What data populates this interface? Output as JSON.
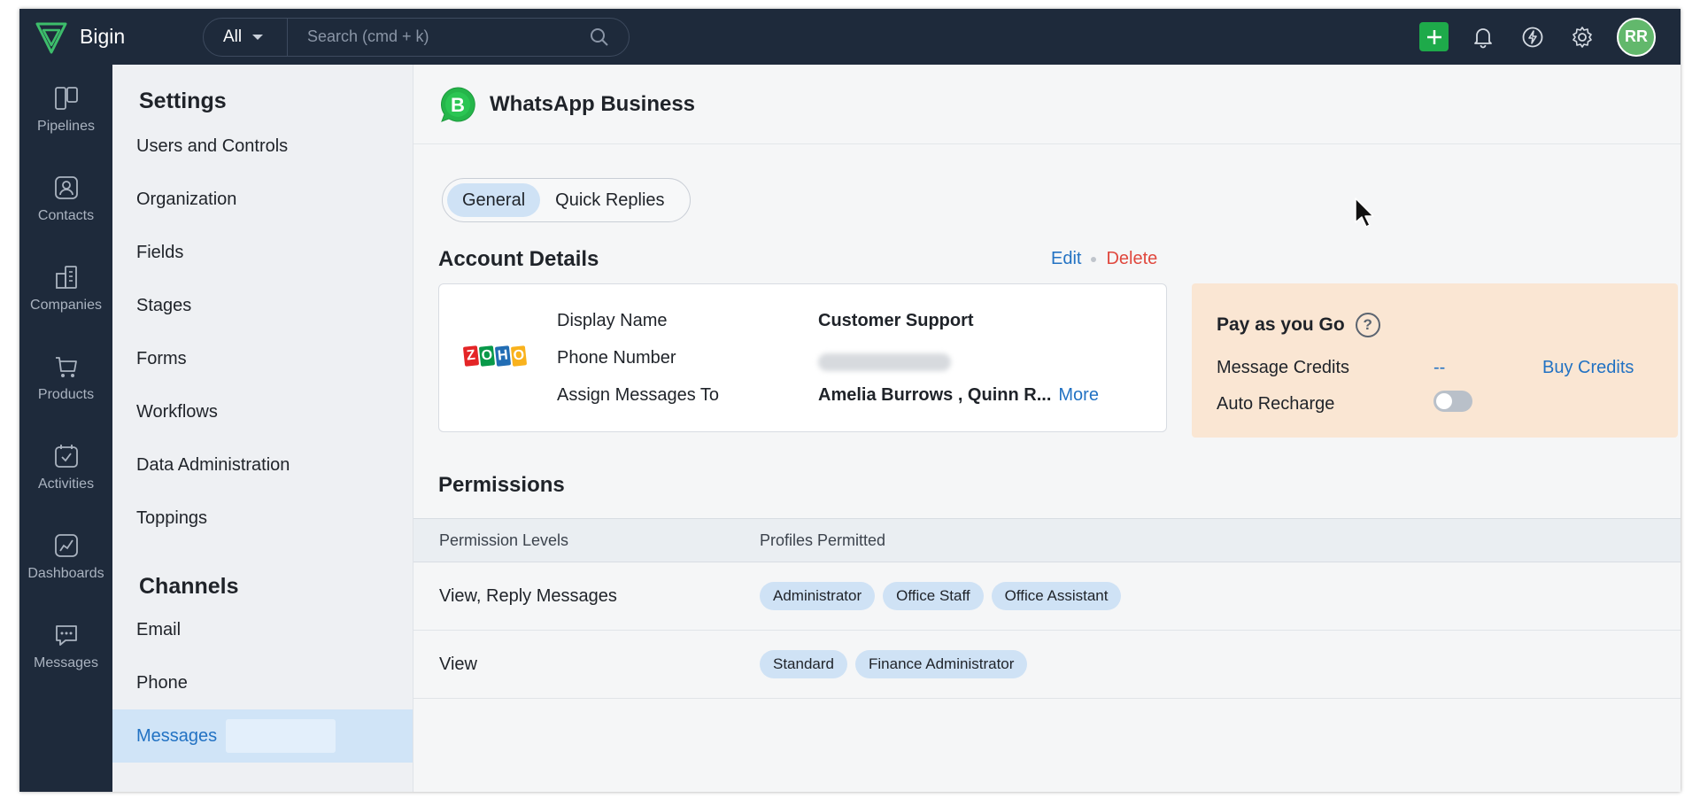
{
  "app": {
    "name": "Bigin"
  },
  "search": {
    "scope": "All",
    "placeholder": "Search (cmd + k)"
  },
  "user": {
    "initials": "RR"
  },
  "nav": [
    {
      "label": "Pipelines",
      "icon": "pipelines-icon"
    },
    {
      "label": "Contacts",
      "icon": "contacts-icon"
    },
    {
      "label": "Companies",
      "icon": "companies-icon"
    },
    {
      "label": "Products",
      "icon": "products-icon"
    },
    {
      "label": "Activities",
      "icon": "activities-icon"
    },
    {
      "label": "Dashboards",
      "icon": "dashboards-icon"
    },
    {
      "label": "Messages",
      "icon": "messages-icon"
    }
  ],
  "settings": {
    "title": "Settings",
    "items": [
      "Users and Controls",
      "Organization",
      "Fields",
      "Stages",
      "Forms",
      "Workflows",
      "Data Administration",
      "Toppings"
    ],
    "channels_title": "Channels",
    "channels": [
      "Email",
      "Phone",
      "Messages"
    ],
    "active_channel": "Messages"
  },
  "main": {
    "title": "WhatsApp Business",
    "tabs": [
      "General",
      "Quick Replies"
    ],
    "active_tab": "General"
  },
  "account": {
    "title": "Account Details",
    "edit": "Edit",
    "delete": "Delete",
    "logo_letters": [
      "Z",
      "O",
      "H",
      "O"
    ],
    "display_name_label": "Display Name",
    "display_name": "Customer Support",
    "phone_label": "Phone Number",
    "assign_label": "Assign Messages To",
    "assign_value": "Amelia Burrows , Quinn R...",
    "more": "More"
  },
  "payg": {
    "title": "Pay as you Go",
    "help": "?",
    "credits_label": "Message Credits",
    "credits_value": "--",
    "buy": "Buy Credits",
    "recharge_label": "Auto Recharge",
    "recharge_on": false
  },
  "permissions": {
    "title": "Permissions",
    "headers": [
      "Permission Levels",
      "Profiles Permitted"
    ],
    "rows": [
      {
        "level": "View, Reply Messages",
        "profiles": [
          "Administrator",
          "Office Staff",
          "Office Assistant"
        ]
      },
      {
        "level": "View",
        "profiles": [
          "Standard",
          "Finance Administrator"
        ]
      }
    ]
  },
  "colors": {
    "topbar": "#1e2a3b",
    "accent": "#2272c3",
    "delete": "#e0483e",
    "add_button": "#1eaa4a",
    "chip": "#cfe2f5",
    "payg_bg": "#fae6d3"
  }
}
